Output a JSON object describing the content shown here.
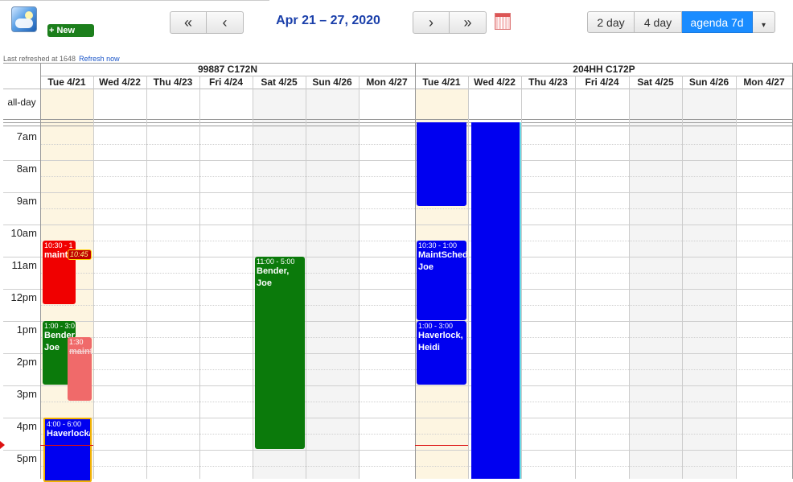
{
  "toolbar": {
    "new_label": "+ New",
    "nav_prev2": "«",
    "nav_prev": "‹",
    "date_range": "Apr 21 – 27, 2020",
    "nav_next": "›",
    "nav_next2": "»",
    "views": [
      "2 day",
      "4 day",
      "agenda 7d"
    ],
    "active_view": "agenda 7d",
    "dropdown": "▾"
  },
  "refresh": {
    "text": "Last refreshed at 1648",
    "link": "Refresh now"
  },
  "resources": [
    {
      "name": "99887 C172N",
      "days": [
        "Tue 4/21",
        "Wed 4/22",
        "Thu 4/23",
        "Fri 4/24",
        "Sat 4/25",
        "Sun 4/26",
        "Mon 4/27"
      ]
    },
    {
      "name": "204HH C172P",
      "days": [
        "Tue 4/21",
        "Wed 4/22",
        "Thu 4/23",
        "Fri 4/24",
        "Sat 4/25",
        "Sun 4/26",
        "Mon 4/27"
      ]
    }
  ],
  "allday_label": "all-day",
  "time_labels": [
    "7am",
    "8am",
    "9am",
    "10am",
    "11am",
    "12pm",
    "1pm",
    "2pm",
    "3pm",
    "4pm",
    "5pm"
  ],
  "events": {
    "e1": {
      "time": "10:30 - 1",
      "title": "maint",
      "color": "#f00000"
    },
    "e1b": {
      "time": "10:45",
      "color": "#c00000"
    },
    "e2": {
      "time": "1:00 - 3:0",
      "title": "Bender, Joe",
      "color": "#0b7a0b"
    },
    "e3": {
      "time": "1:30",
      "title": "maint",
      "color": "#f06a6a"
    },
    "e4": {
      "time": "4:00 - 6:00",
      "title": "Haverlock/I",
      "color": "#0000f0"
    },
    "e5": {
      "time": "11:00 - 5:00",
      "title": "Bender, Joe",
      "color": "#0b7a0b"
    },
    "e6": {
      "time": "",
      "title": "",
      "color": "#0000f0"
    },
    "e7": {
      "time": "10:30 - 1:00",
      "title": "MaintSched Joe",
      "color": "#0000f0"
    },
    "e8": {
      "time": "1:00 - 3:00",
      "title": "Haverlock, Heidi",
      "color": "#0000f0"
    },
    "e9": {
      "time": "",
      "title": "",
      "color": "#0000f0"
    }
  }
}
